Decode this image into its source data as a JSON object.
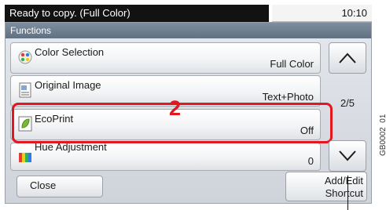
{
  "status": {
    "message": "Ready to copy. (Full Color)",
    "time": "10:10"
  },
  "panel": {
    "title": "Functions"
  },
  "rows": [
    {
      "title": "Color Selection",
      "value": "Full Color",
      "icon": "color-selection-icon"
    },
    {
      "title": "Original Image",
      "value": "Text+Photo",
      "icon": "original-image-icon"
    },
    {
      "title": "EcoPrint",
      "value": "Off",
      "icon": "ecoprint-leaf-icon",
      "highlighted": true
    },
    {
      "title": "Hue Adjustment",
      "value": "0",
      "icon": "hue-adjustment-icon"
    }
  ],
  "pagination": {
    "indicator": "2/5"
  },
  "buttons": {
    "close": "Close",
    "shortcut_line1": "Add/Edit",
    "shortcut_line2": "Shortcut"
  },
  "annotation": {
    "step": "2",
    "figure_id": "GB0002_01"
  },
  "colors": {
    "highlight": "#e2171f",
    "header": "#6b7c8e",
    "status_bg": "#121212"
  }
}
